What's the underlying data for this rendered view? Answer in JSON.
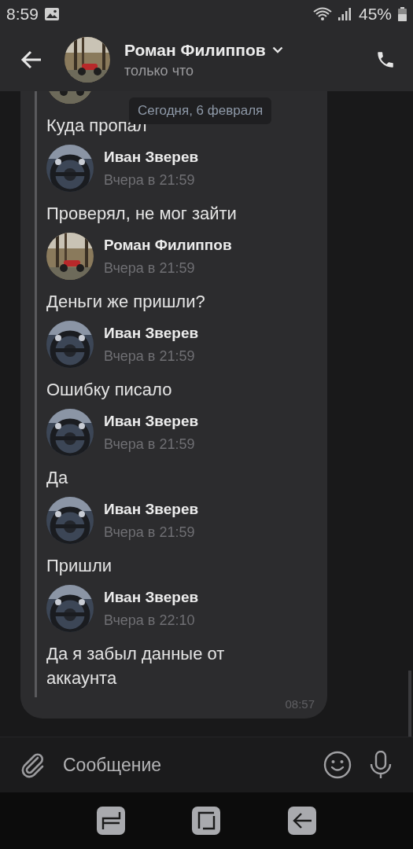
{
  "status_bar": {
    "time": "8:59",
    "battery": "45%"
  },
  "header": {
    "name": "Роман Филиппов",
    "status": "только что"
  },
  "date_badge": "Сегодня, 6 февраля",
  "message": {
    "time": "08:57",
    "forwarded": [
      {
        "text": "Куда пропал"
      },
      {
        "name": "Иван Зверев",
        "time": "Вчера в 21:59",
        "text": "Проверял, не мог зайти"
      },
      {
        "name": "Роман Филиппов",
        "time": "Вчера в 21:59",
        "text": "Деньги же пришли?"
      },
      {
        "name": "Иван Зверев",
        "time": "Вчера в 21:59",
        "text": "Ошибку писало"
      },
      {
        "name": "Иван Зверев",
        "time": "Вчера в 21:59",
        "text": "Да"
      },
      {
        "name": "Иван Зверев",
        "time": "Вчера в 21:59",
        "text": "Пришли"
      },
      {
        "name": "Иван Зверев",
        "time": "Вчера в 22:10",
        "text": "Да я забыл данные от аккаунта"
      }
    ]
  },
  "composer": {
    "placeholder": "Сообщение"
  }
}
